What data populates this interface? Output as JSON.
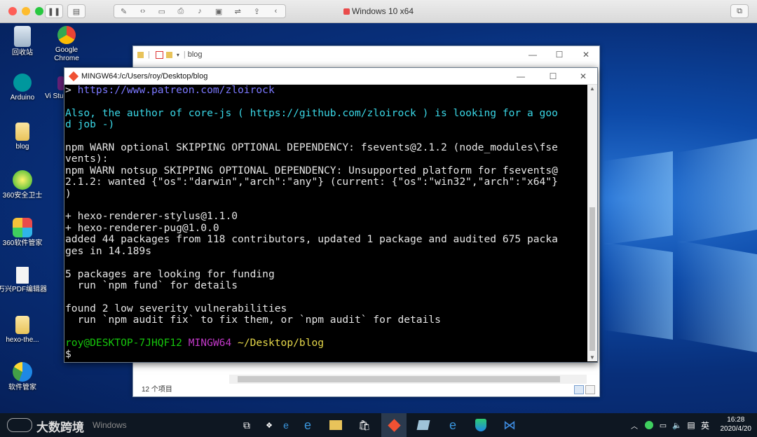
{
  "vm": {
    "title": "Windows 10 x64"
  },
  "desktop_icons": [
    {
      "label": "回收站"
    },
    {
      "label": "Google Chrome"
    },
    {
      "label": "Arduino"
    },
    {
      "label": "Vi Studi"
    },
    {
      "label": "blog"
    },
    {
      "label": "360安全卫士"
    },
    {
      "label": "360软件管家"
    },
    {
      "label": "万兴PDF编辑器"
    },
    {
      "label": "hexo-the..."
    },
    {
      "label": "软件管家"
    }
  ],
  "explorer": {
    "title": "blog",
    "status": "12 个项目"
  },
  "terminal": {
    "title": "MINGW64:/c/Users/roy/Desktop/blog",
    "lines": {
      "l1": "> https://www.patreon.com/zloirock",
      "l2": "Also, the author of core-js ( https://github.com/zloirock ) is looking for a goo",
      "l3": "d job -)",
      "l4": "npm WARN optional SKIPPING OPTIONAL DEPENDENCY: fsevents@2.1.2 (node_modules\\fse",
      "l5": "vents):",
      "l6": "npm WARN notsup SKIPPING OPTIONAL DEPENDENCY: Unsupported platform for fsevents@",
      "l7": "2.1.2: wanted {\"os\":\"darwin\",\"arch\":\"any\"} (current: {\"os\":\"win32\",\"arch\":\"x64\"}",
      "l8": ")",
      "l9": "+ hexo-renderer-stylus@1.1.0",
      "l10": "+ hexo-renderer-pug@1.0.0",
      "l11": "added 44 packages from 118 contributors, updated 1 package and audited 675 packa",
      "l12": "ges in 14.189s",
      "l13": "5 packages are looking for funding",
      "l14": "  run `npm fund` for details",
      "l15": "found 2 low severity vulnerabilities",
      "l16": "  run `npm audit fix` to fix them, or `npm audit` for details",
      "prompt_user": "roy@DESKTOP-7JHQF12",
      "prompt_env": "MINGW64",
      "prompt_path": "~/Desktop/blog",
      "prompt_symbol": "$"
    }
  },
  "taskbar": {
    "search_placeholder": "Windows",
    "watermark": "大数跨境",
    "ime": "英",
    "time": "16:28",
    "date": "2020/4/20"
  },
  "colors": {
    "accent_cyan": "#3ad7e6",
    "link_blue": "#7b78ff",
    "prompt_green": "#16c60c",
    "prompt_magenta": "#c239c8",
    "prompt_yellow": "#e6d84a"
  }
}
